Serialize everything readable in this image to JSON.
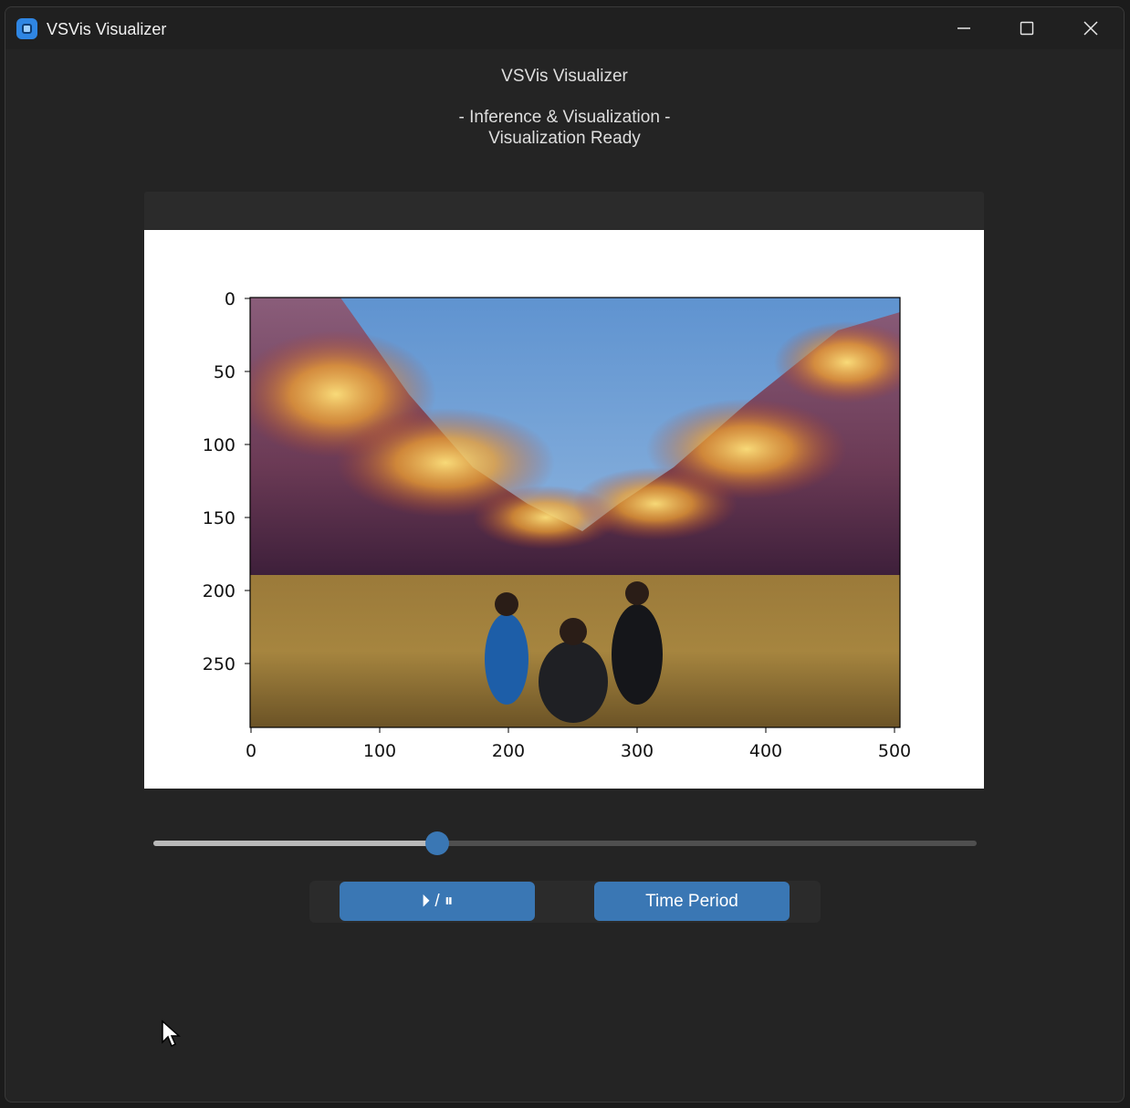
{
  "window": {
    "title": "VSVis Visualizer",
    "controls": [
      "minimize-icon",
      "maximize-icon",
      "close-icon"
    ]
  },
  "header": {
    "title": "VSVis Visualizer",
    "subtitle": "- Inference & Visualization -",
    "status": "Visualization Ready"
  },
  "plot": {
    "y_ticks": [
      "0",
      "50",
      "100",
      "150",
      "200",
      "250"
    ],
    "x_ticks": [
      "0",
      "100",
      "200",
      "300",
      "400",
      "500"
    ],
    "image_content": "saliency heatmap overlay on mountain valley landscape with three people sitting in grass"
  },
  "slider": {
    "value_fraction": 0.345
  },
  "controls": {
    "play_pause_label": "⏵ / ⏸",
    "time_period_label": "Time Period"
  },
  "colors": {
    "accent": "#3a77b4",
    "background": "#242424",
    "titlebar": "#202020"
  }
}
